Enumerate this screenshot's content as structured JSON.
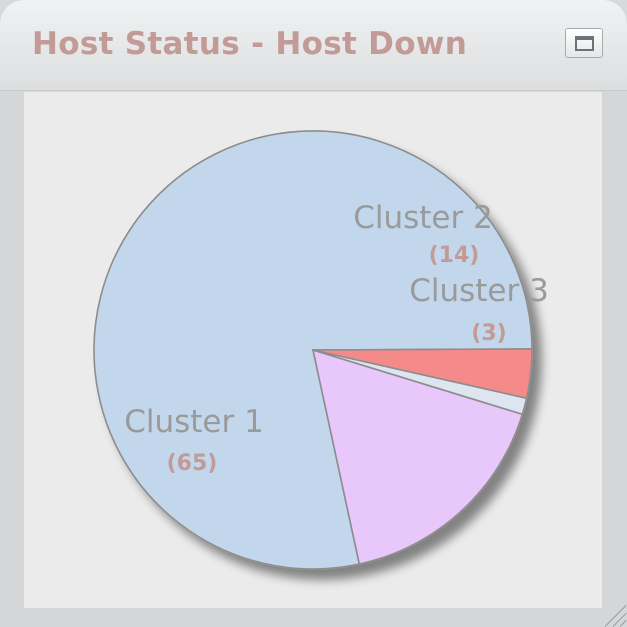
{
  "widget": {
    "title": "Host Status - Host Down"
  },
  "colors": {
    "title_text": "#c39b96",
    "label_text": "#9a9a9a",
    "value_text": "#c39b96",
    "slice_stroke": "#8d8d8d",
    "panel_bg": "#ebebeb"
  },
  "chart_data": {
    "type": "pie",
    "title": "Host Status - Host Down",
    "slices": [
      {
        "name": "Cluster 1",
        "value": 65,
        "label": "(65)",
        "color": "#c2d7ec"
      },
      {
        "name": "Cluster 2",
        "value": 14,
        "label": "(14)",
        "color": "#e8c8fb"
      },
      {
        "name": "Cluster 3",
        "value": 1,
        "label": "",
        "color": "#dde6f0"
      },
      {
        "name": "",
        "value": 3,
        "label": "(3)",
        "color": "#f58a8a"
      }
    ]
  }
}
